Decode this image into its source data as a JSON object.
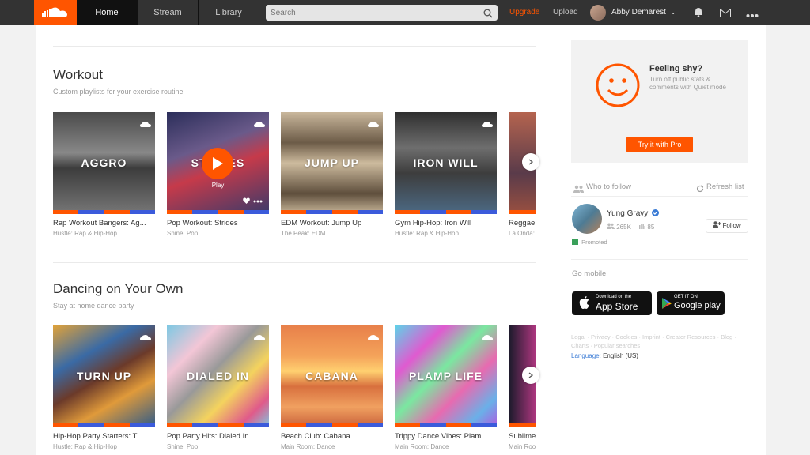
{
  "nav": {
    "tabs": [
      {
        "label": "Home",
        "active": true
      },
      {
        "label": "Stream",
        "active": false
      },
      {
        "label": "Library",
        "active": false
      }
    ],
    "search_placeholder": "Search",
    "upgrade": "Upgrade",
    "upload": "Upload",
    "username": "Abby Demarest"
  },
  "sections": [
    {
      "title": "Workout",
      "subtitle": "Custom playlists for your exercise routine",
      "cards": [
        {
          "cover_label": "AGGRO",
          "title": "Rap Workout Bangers: Ag...",
          "sub": "Hustle: Rap & Hip-Hop"
        },
        {
          "cover_label": "STRIDES",
          "title": "Pop Workout: Strides",
          "sub": "Shine: Pop",
          "hover_label": "Play"
        },
        {
          "cover_label": "JUMP UP",
          "title": "EDM Workout: Jump Up",
          "sub": "The Peak: EDM"
        },
        {
          "cover_label": "IRON WILL",
          "title": "Gym Hip-Hop: Iron Will",
          "sub": "Hustle: Rap & Hip-Hop"
        },
        {
          "cover_label": "",
          "title": "Reggae",
          "sub": "La Onda:"
        }
      ]
    },
    {
      "title": "Dancing on Your Own",
      "subtitle": "Stay at home dance party",
      "cards": [
        {
          "cover_label": "TURN UP",
          "title": "Hip-Hop Party Starters: T...",
          "sub": "Hustle: Rap & Hip-Hop"
        },
        {
          "cover_label": "DIALED IN",
          "title": "Pop Party Hits: Dialed In",
          "sub": "Shine: Pop"
        },
        {
          "cover_label": "CABANA",
          "title": "Beach Club: Cabana",
          "sub": "Main Room: Dance"
        },
        {
          "cover_label": "PLAMP LIFE",
          "title": "Trippy Dance Vibes: Plam...",
          "sub": "Main Room: Dance"
        },
        {
          "cover_label": "",
          "title": "Sublime",
          "sub": "Main Room:"
        }
      ]
    }
  ],
  "sidebar": {
    "pro": {
      "title": "Feeling shy?",
      "text": "Turn off public stats & comments with Quiet mode",
      "button": "Try it with Pro"
    },
    "who_to_follow": "Who to follow",
    "refresh": "Refresh list",
    "follow": {
      "name": "Yung Gravy",
      "followers": "265K",
      "tracks": "85",
      "button": "Follow",
      "promoted": "Promoted"
    },
    "go_mobile": "Go mobile",
    "app_store": {
      "small": "Download on the",
      "big": "App Store"
    },
    "google_play": {
      "small": "GET IT ON",
      "big": "Google play"
    },
    "footer_links": "Legal · Privacy · Cookies · Imprint · Creator Resources · Blog · Charts · Popular searches",
    "language_label": "Language:",
    "language_value": "English (US)"
  },
  "colors": {
    "accent": "#ff5500",
    "nav_bg": "#333333"
  }
}
